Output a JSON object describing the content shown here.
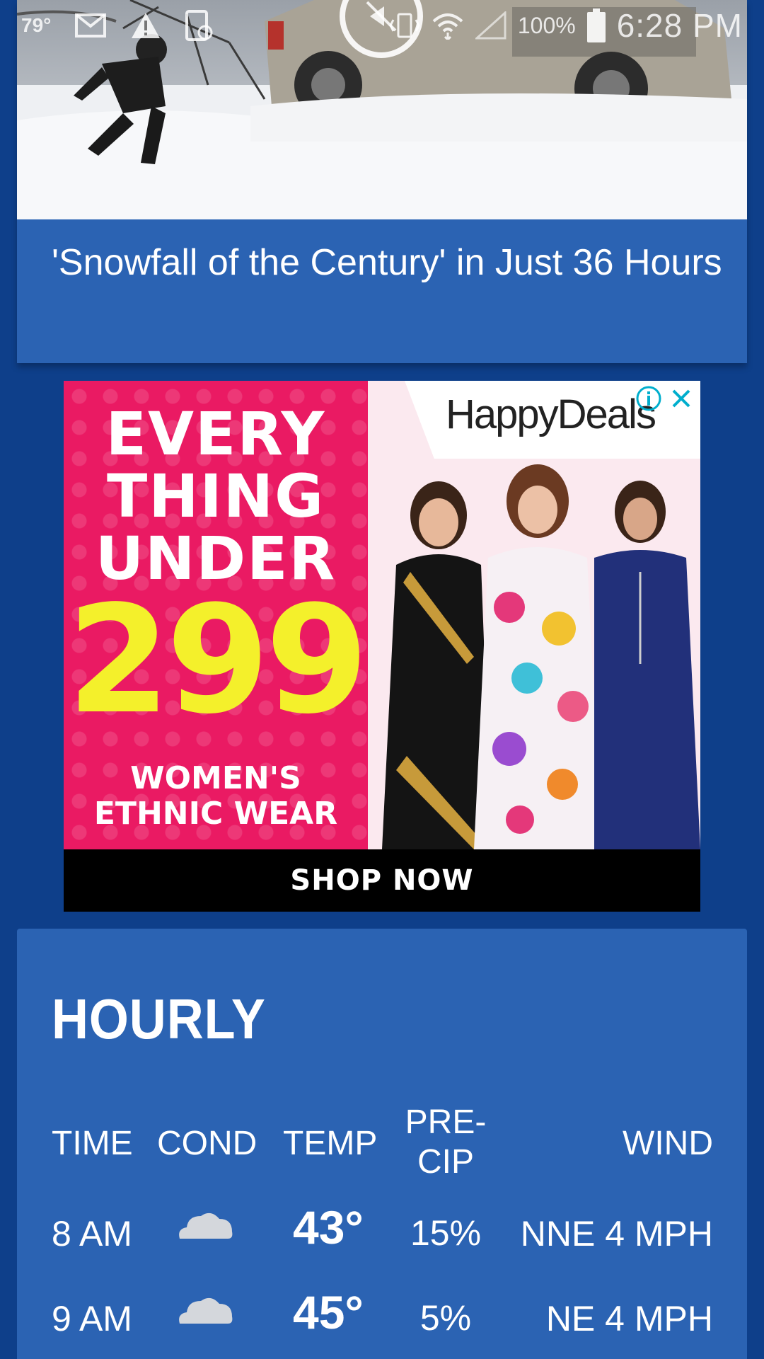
{
  "status_bar": {
    "temperature": "79°",
    "battery": "100%",
    "time": "6:28 PM",
    "icons": [
      "mail-icon",
      "warning-icon",
      "screen-lock-icon",
      "play-icon",
      "vibrate-icon",
      "wifi-icon",
      "signal-icon",
      "battery-icon"
    ]
  },
  "news": {
    "headline": "'Snowfall of the Century' in Just 36 Hours"
  },
  "ad": {
    "line1": "EVERY",
    "line2": "THING",
    "line3": "UNDER",
    "price": "299",
    "sub1": "WOMEN'S",
    "sub2": "ETHNIC WEAR",
    "brand": "HappyDeals",
    "cta": "SHOP NOW",
    "colors": {
      "pink": "#ea1a63",
      "yellow": "#f4f02b"
    }
  },
  "hourly": {
    "title": "HOURLY",
    "headers": {
      "time": "TIME",
      "cond": "COND",
      "temp": "TEMP",
      "precip": "PRE-\nCIP",
      "wind": "WIND"
    },
    "rows": [
      {
        "time": "8 AM",
        "cond_icon": "cloud-icon",
        "temp": "43°",
        "precip": "15%",
        "wind": "NNE 4 MPH"
      },
      {
        "time": "9 AM",
        "cond_icon": "cloud-icon",
        "temp": "45°",
        "precip": "5%",
        "wind": "NE 4 MPH"
      }
    ]
  },
  "colors": {
    "background": "#0e3f8a",
    "card": "#2b63b3"
  }
}
